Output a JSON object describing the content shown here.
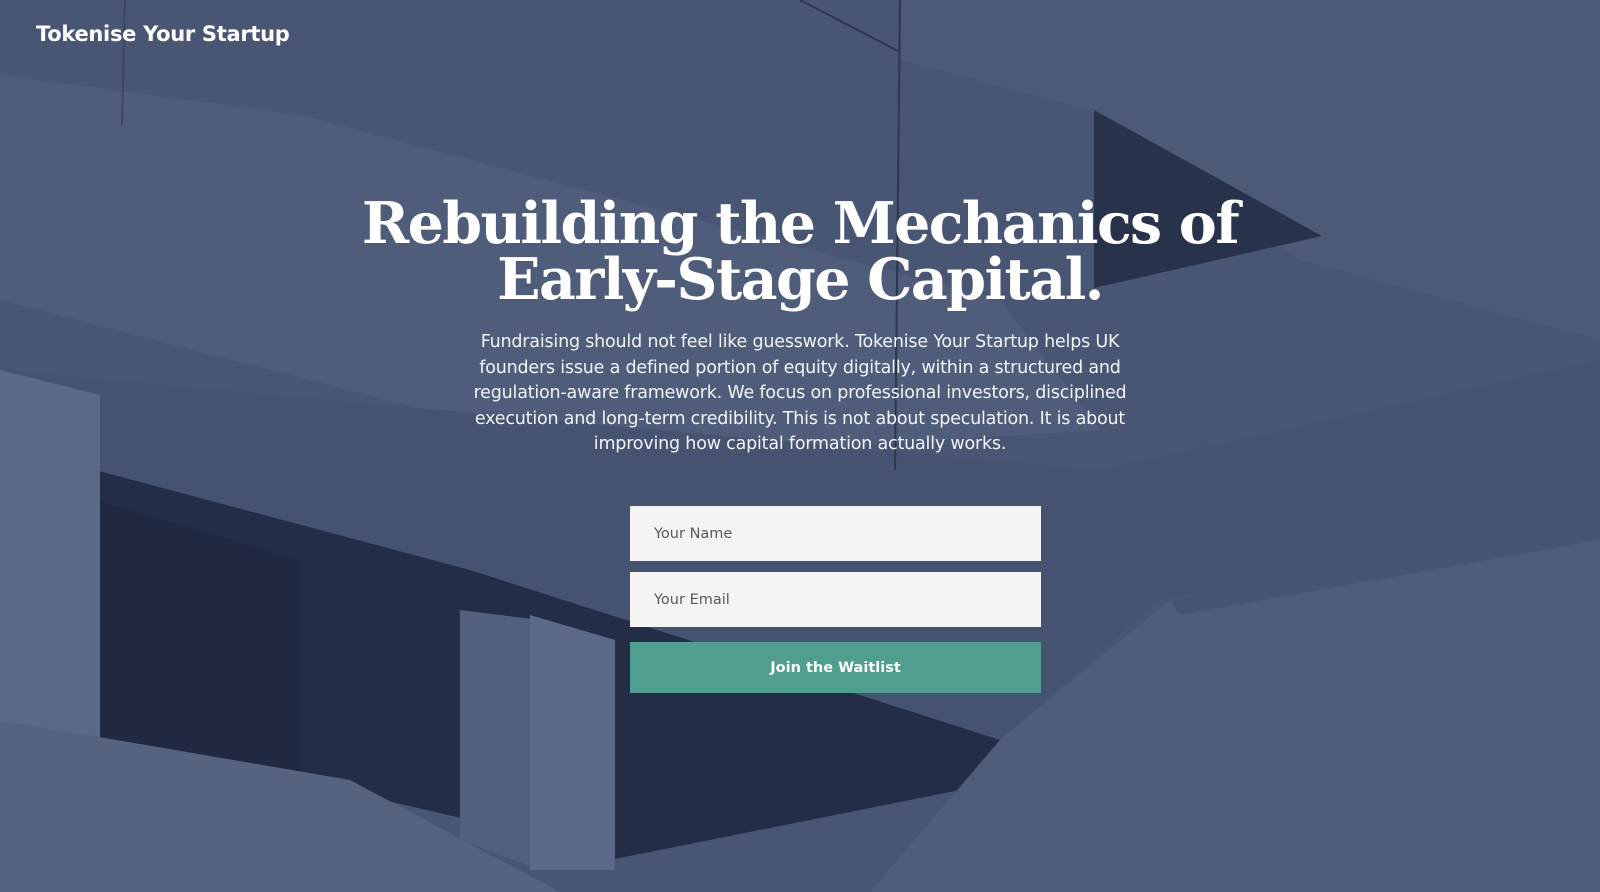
{
  "brand": {
    "name": "Tokenise Your Startup"
  },
  "hero": {
    "headline_line1": "Rebuilding the Mechanics of",
    "headline_line2": "Early-Stage Capital.",
    "description": "Fundraising should not feel like guesswork. Tokenise Your Startup helps UK founders issue a defined portion of equity digitally, within a structured and regulation-aware framework. We focus on professional investors, disciplined execution and long-term credibility. This is not about speculation. It is about improving how capital formation actually works."
  },
  "form": {
    "name_placeholder": "Your Name",
    "email_placeholder": "Your Email",
    "submit_label": "Join the Waitlist"
  },
  "colors": {
    "overlay": "#4b5875",
    "button": "#4f9e8f",
    "input_bg": "#f4f4f4",
    "text": "#ffffff"
  }
}
